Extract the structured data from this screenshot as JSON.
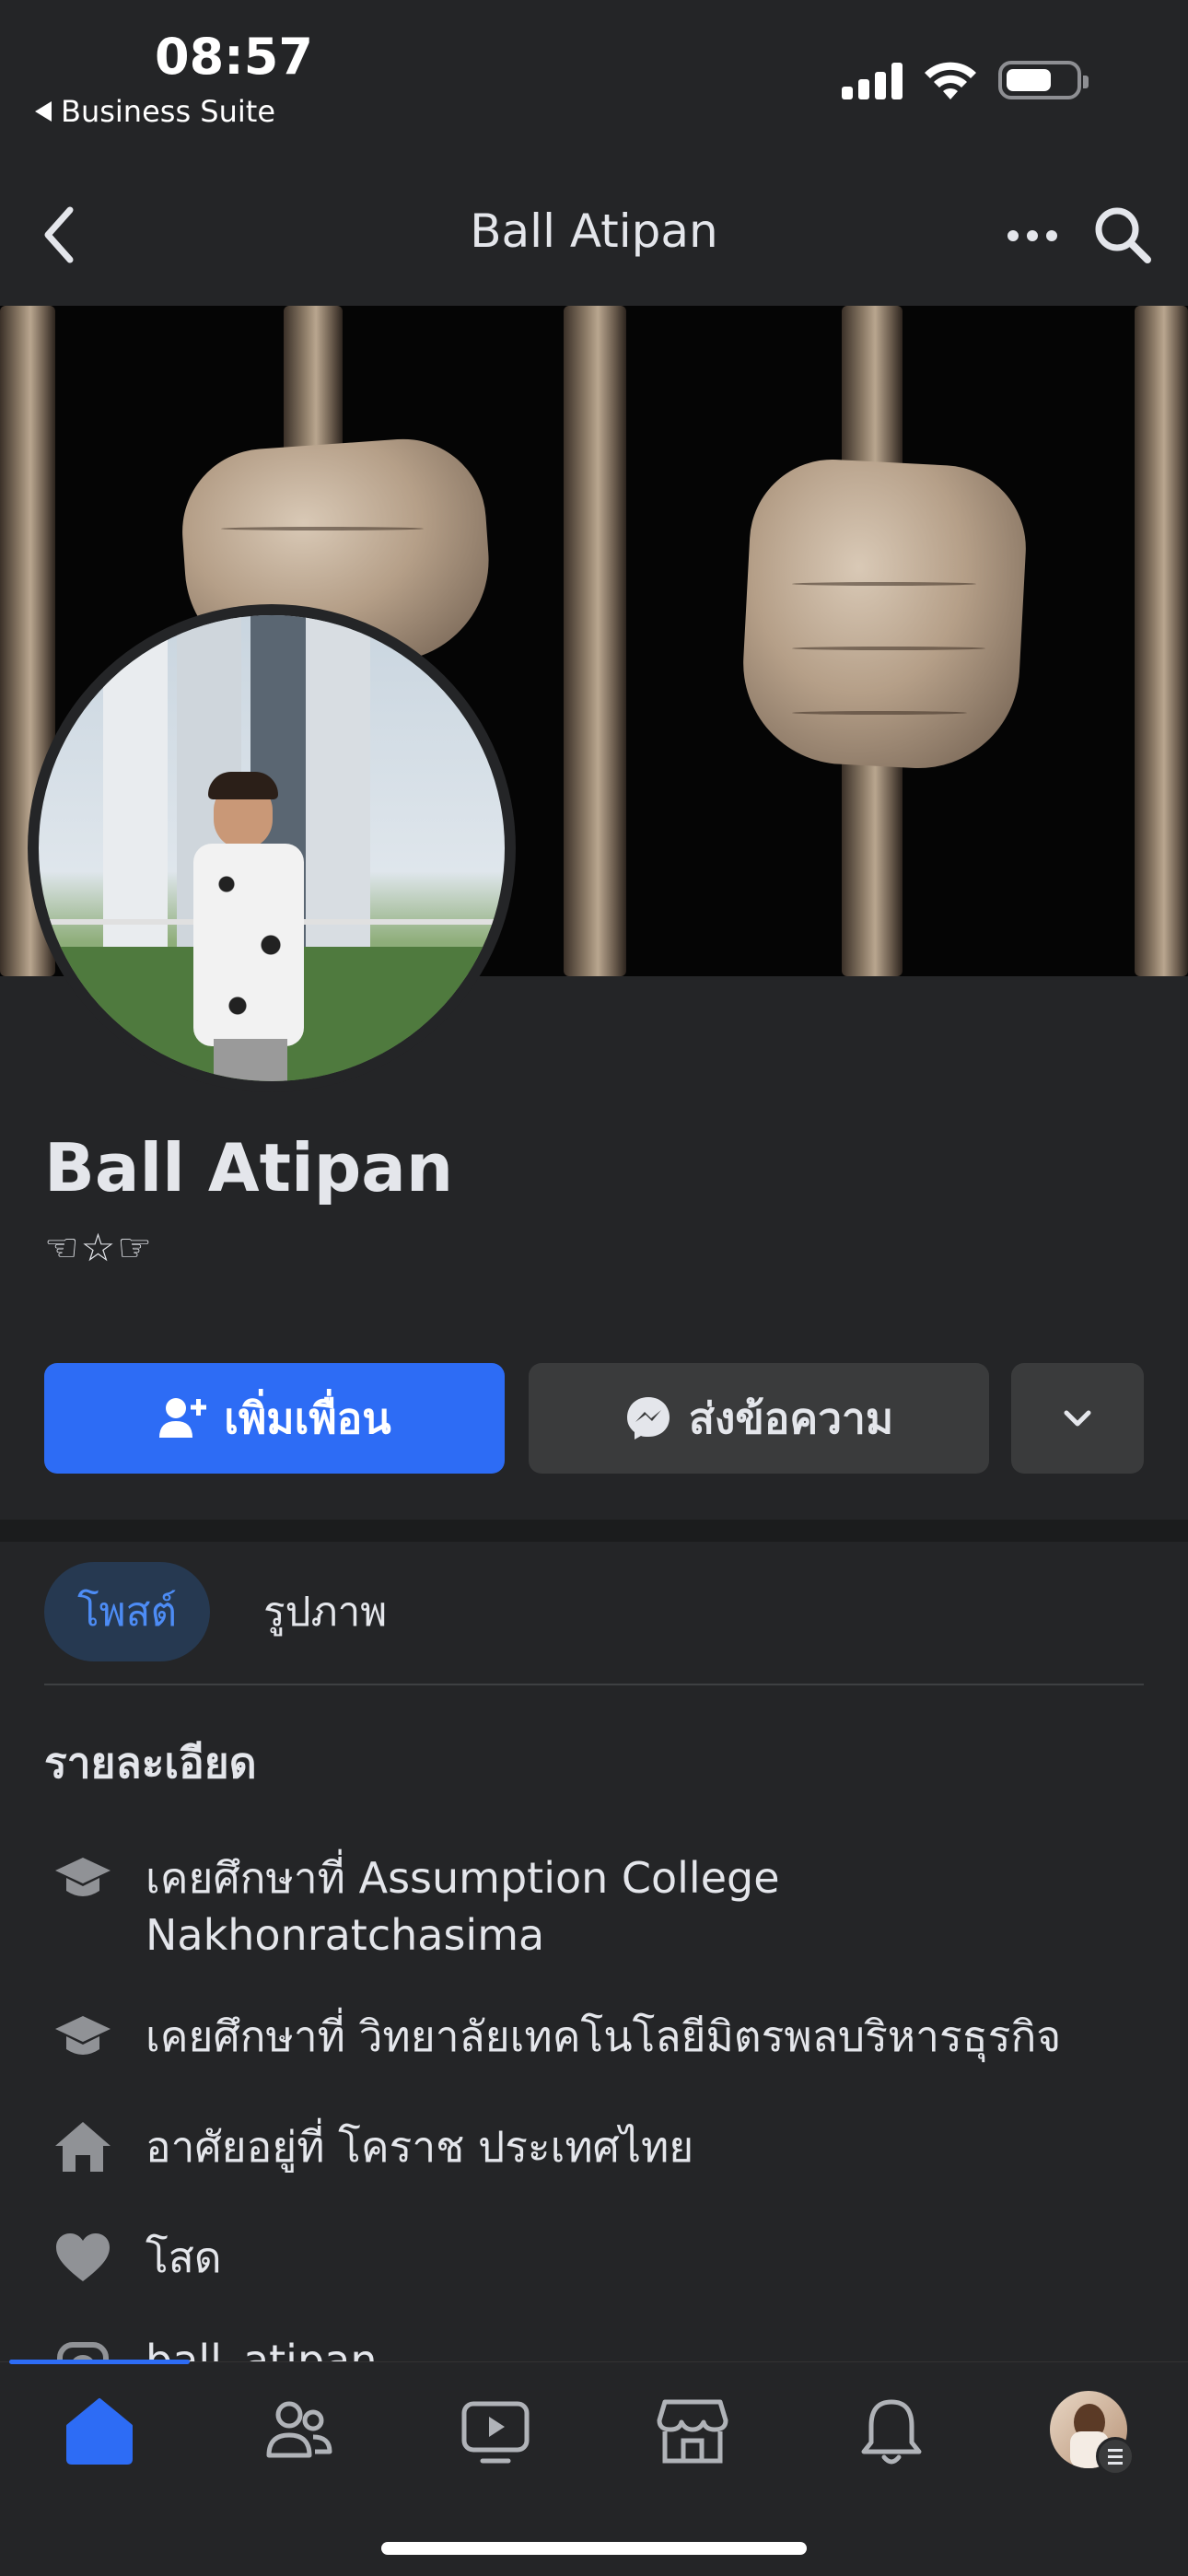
{
  "status_bar": {
    "time": "08:57",
    "back_app_label": "Business Suite"
  },
  "header": {
    "title": "Ball Atipan",
    "icons": [
      "chevron-left-icon",
      "more-icon",
      "search-icon"
    ]
  },
  "profile": {
    "name": "Ball Atipan",
    "bio": "☜☆☞"
  },
  "actions": {
    "add_friend_label": "เพิ่มเพื่อน",
    "message_label": "ส่งข้อความ"
  },
  "tabs": [
    {
      "label": "โพสต์",
      "active": true
    },
    {
      "label": "รูปภาพ",
      "active": false
    }
  ],
  "details": {
    "heading": "รายละเอียด",
    "items": [
      {
        "icon": "graduation-cap-icon",
        "text": "เคยศึกษาที่ Assumption College Nakhonratchasima"
      },
      {
        "icon": "graduation-cap-icon",
        "text": "เคยศึกษาที่ วิทยาลัยเทคโนโลยีมิตรพลบริหารธุรกิจ"
      },
      {
        "icon": "home-icon",
        "text": "อาศัยอยู่ที่ โคราช ประเทศไทย"
      },
      {
        "icon": "heart-icon",
        "text": "โสด"
      },
      {
        "icon": "instagram-icon",
        "text": "ball_atipan"
      }
    ]
  },
  "bottom_nav": {
    "items": [
      "home-icon",
      "friends-icon",
      "video-icon",
      "marketplace-icon",
      "bell-icon",
      "profile-avatar"
    ],
    "active": "home-icon"
  },
  "colors": {
    "background": "#242527",
    "primary_button": "#2d6cf5",
    "secondary_button": "#3a3b3c",
    "active_tab_bg": "#263951",
    "active_tab_text": "#4d8cf5"
  }
}
